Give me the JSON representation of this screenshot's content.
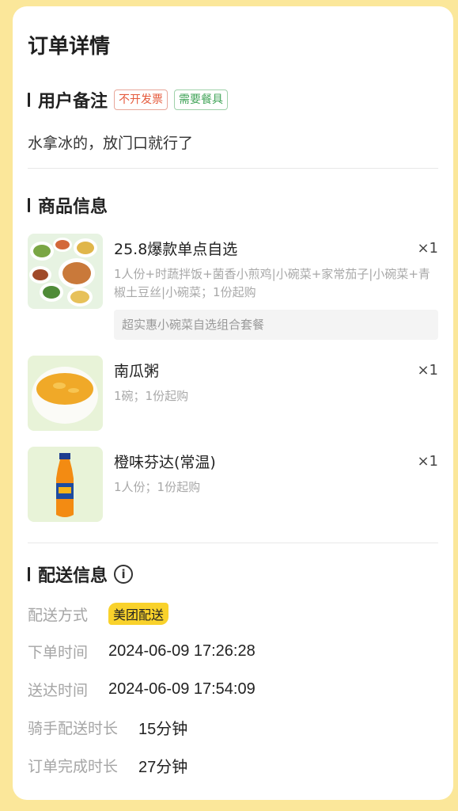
{
  "page_title": "订单详情",
  "remarks": {
    "title": "用户备注",
    "tags": [
      "不开发票",
      "需要餐具"
    ],
    "text": "水拿冰的，放门口就行了"
  },
  "goods": {
    "title": "商品信息",
    "items": [
      {
        "name": "25.8爆款单点自选",
        "qty": "×1",
        "desc": "1人份+时蔬拌饭+菌香小煎鸡|小碗菜+家常茄子|小碗菜+青椒土豆丝|小碗菜；1份起购",
        "promo": "超实惠小碗菜自选组合套餐"
      },
      {
        "name": "南瓜粥",
        "qty": "×1",
        "desc": "1碗；1份起购"
      },
      {
        "name": "橙味芬达(常温)",
        "qty": "×1",
        "desc": "1人份；1份起购"
      }
    ]
  },
  "delivery": {
    "title": "配送信息",
    "info_icon": "info-icon",
    "rows": [
      {
        "label": "配送方式",
        "value": "美团配送"
      },
      {
        "label": "下单时间",
        "value": "2024-06-09 17:26:28"
      },
      {
        "label": "送达时间",
        "value": "2024-06-09 17:54:09"
      },
      {
        "label": "骑手配送时长",
        "value": "15分钟"
      },
      {
        "label": "订单完成时长",
        "value": "27分钟"
      }
    ]
  },
  "colors": {
    "background": "#fbe79a",
    "badge": "#f9d22b",
    "tag_red": "#e55a3c",
    "tag_green": "#44a55b"
  }
}
